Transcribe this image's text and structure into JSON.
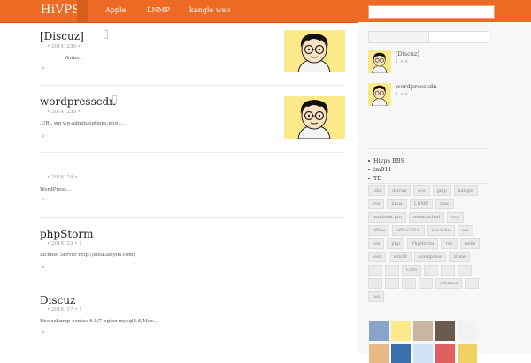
{
  "header": {
    "logo": "HiVPS",
    "nav": [
      "Apple",
      "LNMP",
      "kangle web"
    ],
    "search_placeholder": ""
  },
  "posts": [
    {
      "title": "[Discuz]",
      "date": "20141230",
      "count": "",
      "excerpt": "&nbs...",
      "more": "»",
      "has_thumb": true
    },
    {
      "title": "wordpresscdn",
      "date": "20141230",
      "count": "",
      "excerpt": ".URL wp  wp-admin/options.php  ...",
      "more": "»",
      "has_thumb": true
    },
    {
      "title": "",
      "date": "2016124",
      "count": "",
      "excerpt": "WordPress...",
      "more": "»",
      "has_thumb": false
    },
    {
      "title": "phpStorm",
      "date": "2016123",
      "count": "1",
      "excerpt": "License Server http://idea.lanyus.com/",
      "more": "»",
      "has_thumb": false
    },
    {
      "title": "Discuz",
      "date": "2016117",
      "count": "1",
      "excerpt": "DiscuzLnmp  centos 6.5/7  nginx mysql5.6/Mar...",
      "more": "»",
      "has_thumb": false
    }
  ],
  "sidebar": {
    "recent": [
      {
        "title": "[Discuz]",
        "meta": "1 × 6"
      },
      {
        "title": "wordpresscdn",
        "meta": "1 × 6"
      }
    ],
    "links": [
      "Hivps BBS",
      "im911",
      "TD"
    ],
    "tags": [
      "cdn",
      "discuz",
      "ecs",
      "gmp",
      "kangle",
      "kvs",
      "linux",
      "LNMP",
      "mac",
      "macbook pro",
      "memcached",
      "ocs",
      "office",
      "office2016",
      "opcache",
      "oss",
      "osx",
      "php",
      "PhpStorm",
      "rds",
      "redis",
      "web",
      "win10",
      "wordpress",
      "zlone",
      "",
      "",
      "CDN",
      "",
      "",
      "",
      "",
      "",
      "",
      "",
      "adsense",
      "",
      "oss"
    ],
    "friend_colors": [
      "#8aa4c8",
      "#fbe98a",
      "#c8b6a0",
      "#6b5a4e",
      "#f2f2f2",
      "#e8b887",
      "#3a6fb0",
      "#cfe3f4",
      "#e06060",
      "#f0d060"
    ]
  }
}
